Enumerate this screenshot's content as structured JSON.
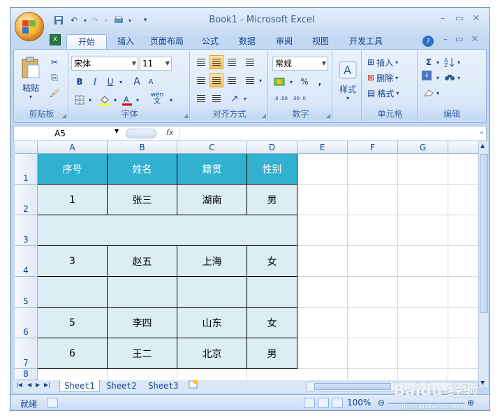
{
  "window": {
    "title": "Book1 - Microsoft Excel"
  },
  "ribbon_tabs": [
    "开始",
    "插入",
    "页面布局",
    "公式",
    "数据",
    "审阅",
    "视图",
    "开发工具"
  ],
  "clipboard": {
    "paste_label": "粘贴",
    "group_label": "剪贴板"
  },
  "font": {
    "name": "宋体",
    "size": "11",
    "group_label": "字体",
    "bold": "B",
    "italic": "I",
    "underline": "U",
    "grow": "A",
    "shrink": "A",
    "phonetic": "wén"
  },
  "alignment": {
    "group_label": "对齐方式"
  },
  "number": {
    "format": "常规",
    "percent": "%",
    "comma": ",",
    "group_label": "数字",
    "inc_dec": ".0 .00",
    "dec_dec": ".00 .0"
  },
  "styles": {
    "label": "样式"
  },
  "cells": {
    "insert": "插入",
    "delete": "删除",
    "format": "格式",
    "group_label": "单元格"
  },
  "editing": {
    "group_label": "编辑",
    "sum": "Σ"
  },
  "formula_bar": {
    "name_box": "A5",
    "fx": "fx"
  },
  "columns": [
    "A",
    "B",
    "C",
    "D",
    "E",
    "F",
    "G"
  ],
  "rows": [
    "1",
    "2",
    "3",
    "4",
    "5",
    "6",
    "7",
    "8"
  ],
  "table": {
    "header": [
      "序号",
      "姓名",
      "籍贯",
      "性别"
    ],
    "row2": [
      "1",
      "张三",
      "湖南",
      "男"
    ],
    "row4": [
      "3",
      "赵五",
      "上海",
      "女"
    ],
    "row6": [
      "5",
      "李四",
      "山东",
      "女"
    ],
    "row7": [
      "6",
      "王二",
      "北京",
      "男"
    ]
  },
  "sheet_tabs": [
    "Sheet1",
    "Sheet2",
    "Sheet3"
  ],
  "status": {
    "ready": "就绪",
    "zoom": "100%"
  },
  "watermark": {
    "text": "Baidu 经验",
    "url": "jingyan.baidu.com"
  },
  "colors": {
    "header_fill": "#31b0d0",
    "table_fill": "#daeef3",
    "ribbon": "#dbe8f8"
  }
}
